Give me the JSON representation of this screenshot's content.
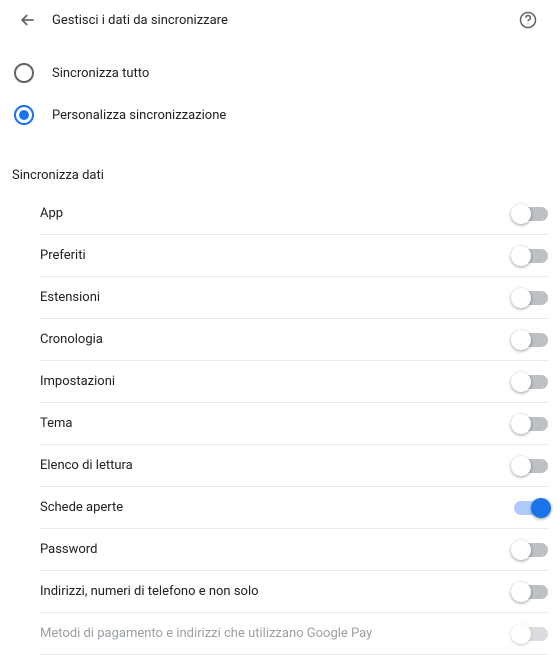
{
  "header": {
    "title": "Gestisci i dati da sincronizzare"
  },
  "radio": {
    "options": [
      {
        "label": "Sincronizza tutto",
        "selected": false
      },
      {
        "label": "Personalizza sincronizzazione",
        "selected": true
      }
    ]
  },
  "section_title": "Sincronizza dati",
  "items": [
    {
      "label": "App",
      "on": false,
      "disabled": false
    },
    {
      "label": "Preferiti",
      "on": false,
      "disabled": false
    },
    {
      "label": "Estensioni",
      "on": false,
      "disabled": false
    },
    {
      "label": "Cronologia",
      "on": false,
      "disabled": false
    },
    {
      "label": "Impostazioni",
      "on": false,
      "disabled": false
    },
    {
      "label": "Tema",
      "on": false,
      "disabled": false
    },
    {
      "label": "Elenco di lettura",
      "on": false,
      "disabled": false
    },
    {
      "label": "Schede aperte",
      "on": true,
      "disabled": false
    },
    {
      "label": "Password",
      "on": false,
      "disabled": false
    },
    {
      "label": "Indirizzi, numeri di telefono e non solo",
      "on": false,
      "disabled": false
    },
    {
      "label": "Metodi di pagamento e indirizzi che utilizzano Google Pay",
      "on": false,
      "disabled": true
    }
  ]
}
